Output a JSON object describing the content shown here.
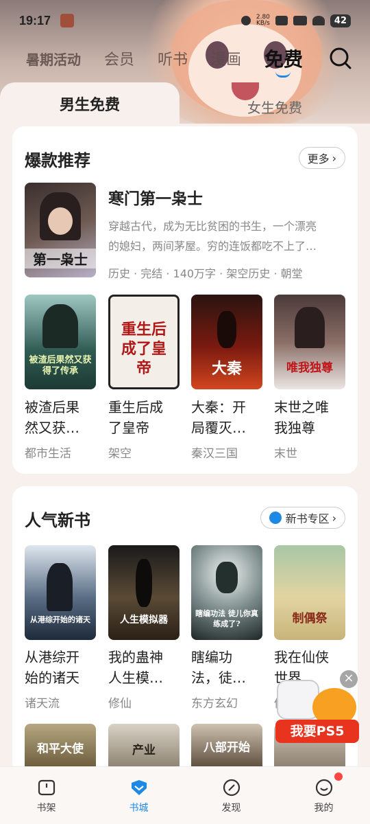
{
  "status_bar": {
    "time": "19:17",
    "net_speed_top": "2.80",
    "net_speed_bottom": "KB/s",
    "battery": "42"
  },
  "top_nav": {
    "tabs": [
      "暑期活动",
      "会员",
      "听书",
      "漫画",
      "免费"
    ],
    "active": "免费"
  },
  "sub_tabs": {
    "left": "男生免费",
    "right": "女生免费"
  },
  "hot_section": {
    "title": "爆款推荐",
    "more_label": "更多",
    "featured": {
      "title": "寒门第一枭士",
      "desc_line1": "穿越古代，成为无比贫困的书生，一个漂亮",
      "desc_line2": "的媳妇，两间茅屋。穷的连饭都吃不上了…",
      "meta": "历史 · 完结 · 140万字 · 架空历史 · 朝堂",
      "cover_text": "第一枭士"
    },
    "books": [
      {
        "line1": "被渣后果",
        "line2": "然又获…",
        "category": "都市生活",
        "cover_text": "被渣后果然又获得了传承"
      },
      {
        "line1": "重生后成",
        "line2": "了皇帝",
        "category": "架空",
        "cover_text": "重生后成了皇帝"
      },
      {
        "line1": "大秦：开",
        "line2": "局覆灭…",
        "category": "秦汉三国",
        "cover_text": "大秦"
      },
      {
        "line1": "末世之唯",
        "line2": "我独尊",
        "category": "末世",
        "cover_text": "唯我独尊"
      }
    ]
  },
  "new_section": {
    "title": "人气新书",
    "more_label": "新书专区",
    "books": [
      {
        "line1": "从港综开",
        "line2": "始的诸天",
        "category": "诸天流",
        "cover_text": "从港综开始的诸天"
      },
      {
        "line1": "我的蛊神",
        "line2": "人生模…",
        "category": "修仙",
        "cover_text": "人生模拟器"
      },
      {
        "line1": "瞎编功",
        "line2": "法，徒…",
        "category": "东方玄幻",
        "cover_text": "瞎编功法 徒儿你真练成了?"
      },
      {
        "line1": "我在仙侠",
        "line2": "世界…",
        "category": "修",
        "cover_text": "制偶祭"
      }
    ],
    "peek_covers": [
      "和平大使",
      "产业",
      "八部开始"
    ]
  },
  "float_ad": {
    "label": "我要PS5"
  },
  "tab_bar": {
    "items": [
      "书架",
      "书城",
      "发现",
      "我的"
    ],
    "active": "书城"
  },
  "colors": {
    "accent": "#1e88e5",
    "badge": "#ff4444"
  }
}
